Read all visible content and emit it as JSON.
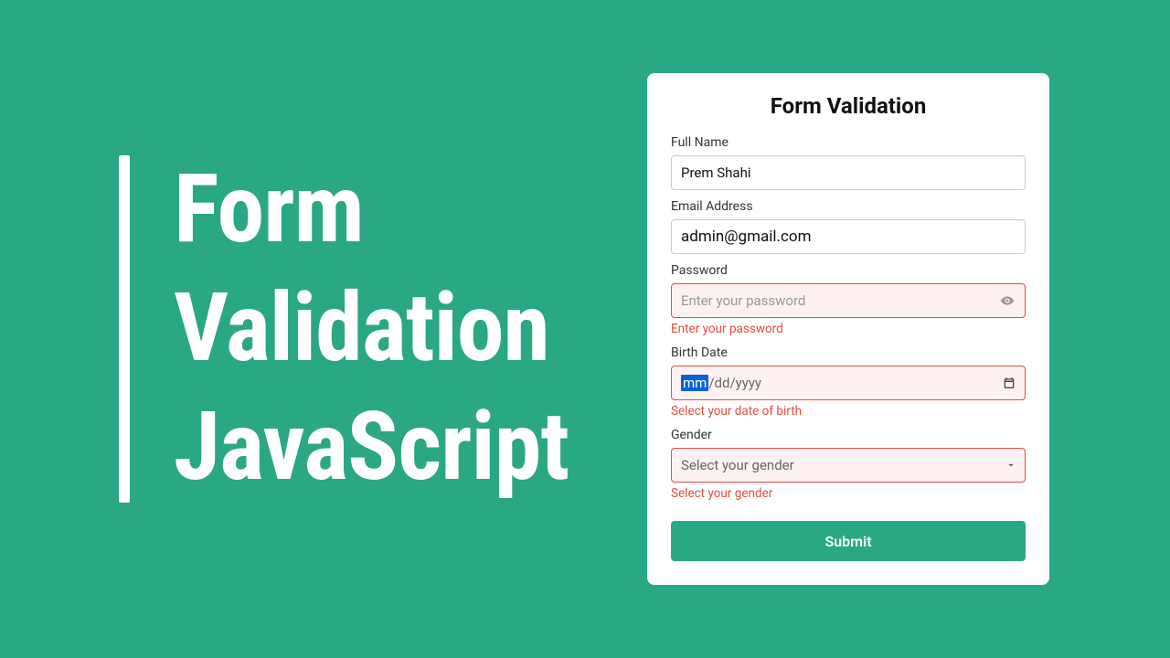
{
  "headline": {
    "line1": "Form",
    "line2": "Validation",
    "line3": "JavaScript"
  },
  "card": {
    "title": "Form Validation",
    "fields": {
      "fullname": {
        "label": "Full Name",
        "value": "Prem Shahi"
      },
      "email": {
        "label": "Email Address",
        "value": "admin@gmail.com"
      },
      "password": {
        "label": "Password",
        "placeholder": "Enter your password",
        "error": "Enter your password"
      },
      "birthdate": {
        "label": "Birth Date",
        "mm": "mm",
        "sep1": "/",
        "dd": "dd",
        "sep2": "/",
        "yyyy": "yyyy",
        "error": "Select your date of birth"
      },
      "gender": {
        "label": "Gender",
        "selected": "Select your gender",
        "error": "Select your gender"
      }
    },
    "submit": "Submit"
  },
  "colors": {
    "bg": "#2aa783",
    "error": "#e74c3c"
  }
}
